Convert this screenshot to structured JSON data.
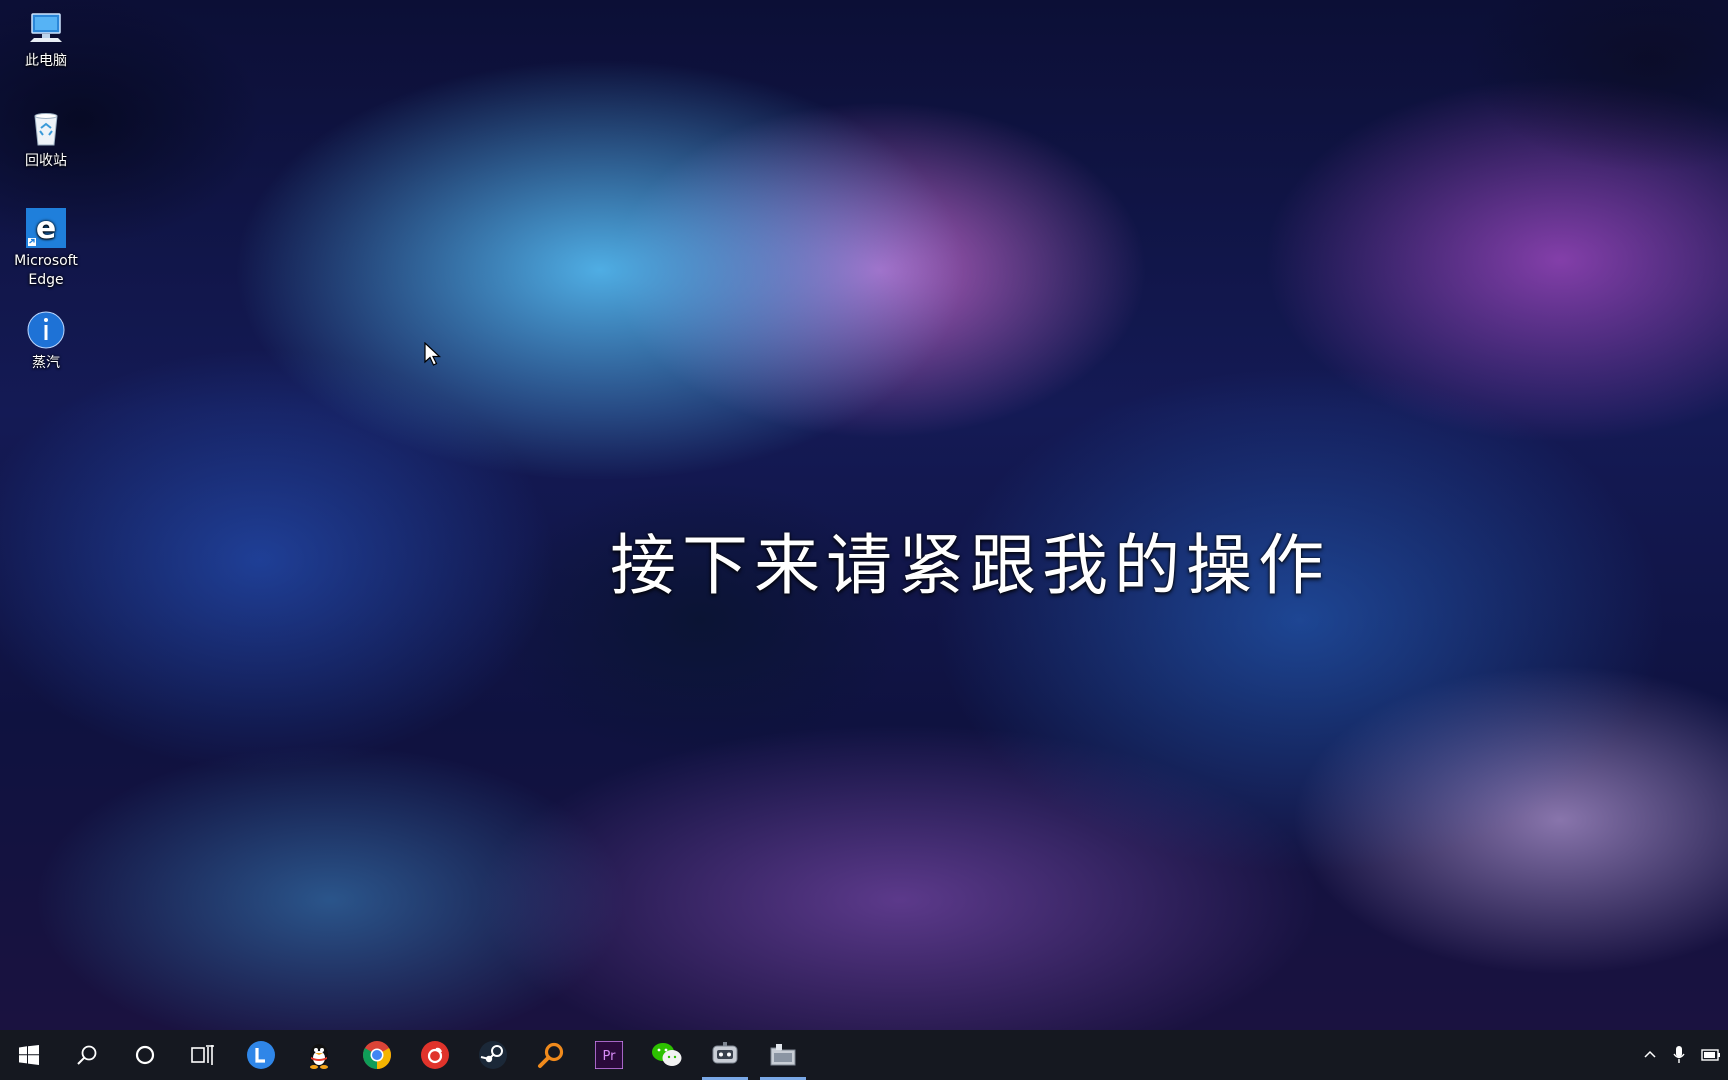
{
  "desktop": {
    "icons": [
      {
        "label": "此电脑",
        "icon": "this-pc-icon"
      },
      {
        "label": "回收站",
        "icon": "recycle-bin-icon"
      },
      {
        "label": "Microsoft Edge",
        "icon": "edge-icon"
      },
      {
        "label": "蒸汽",
        "icon": "steam-info-icon"
      }
    ],
    "subtitle": "接下来请紧跟我的操作"
  },
  "taskbar": {
    "buttons": [
      {
        "icon": "windows-start-icon"
      },
      {
        "icon": "search-icon"
      },
      {
        "icon": "cortana-icon"
      },
      {
        "icon": "task-view-icon"
      },
      {
        "icon": "lenovo-l-icon"
      },
      {
        "icon": "qq-penguin-icon"
      },
      {
        "icon": "chrome-icon"
      },
      {
        "icon": "netease-music-icon"
      },
      {
        "icon": "steam-icon"
      },
      {
        "icon": "search-tool-icon"
      },
      {
        "icon": "premiere-pro-icon",
        "text": "Pr"
      },
      {
        "icon": "wechat-icon"
      },
      {
        "icon": "app-robot-icon"
      },
      {
        "icon": "app-folder-icon"
      }
    ],
    "tray": [
      {
        "icon": "chevron-up-icon"
      },
      {
        "icon": "microphone-icon"
      },
      {
        "icon": "battery-icon"
      }
    ],
    "colors": {
      "background": "#151820",
      "active_indicator": "#7aa8e6"
    }
  }
}
